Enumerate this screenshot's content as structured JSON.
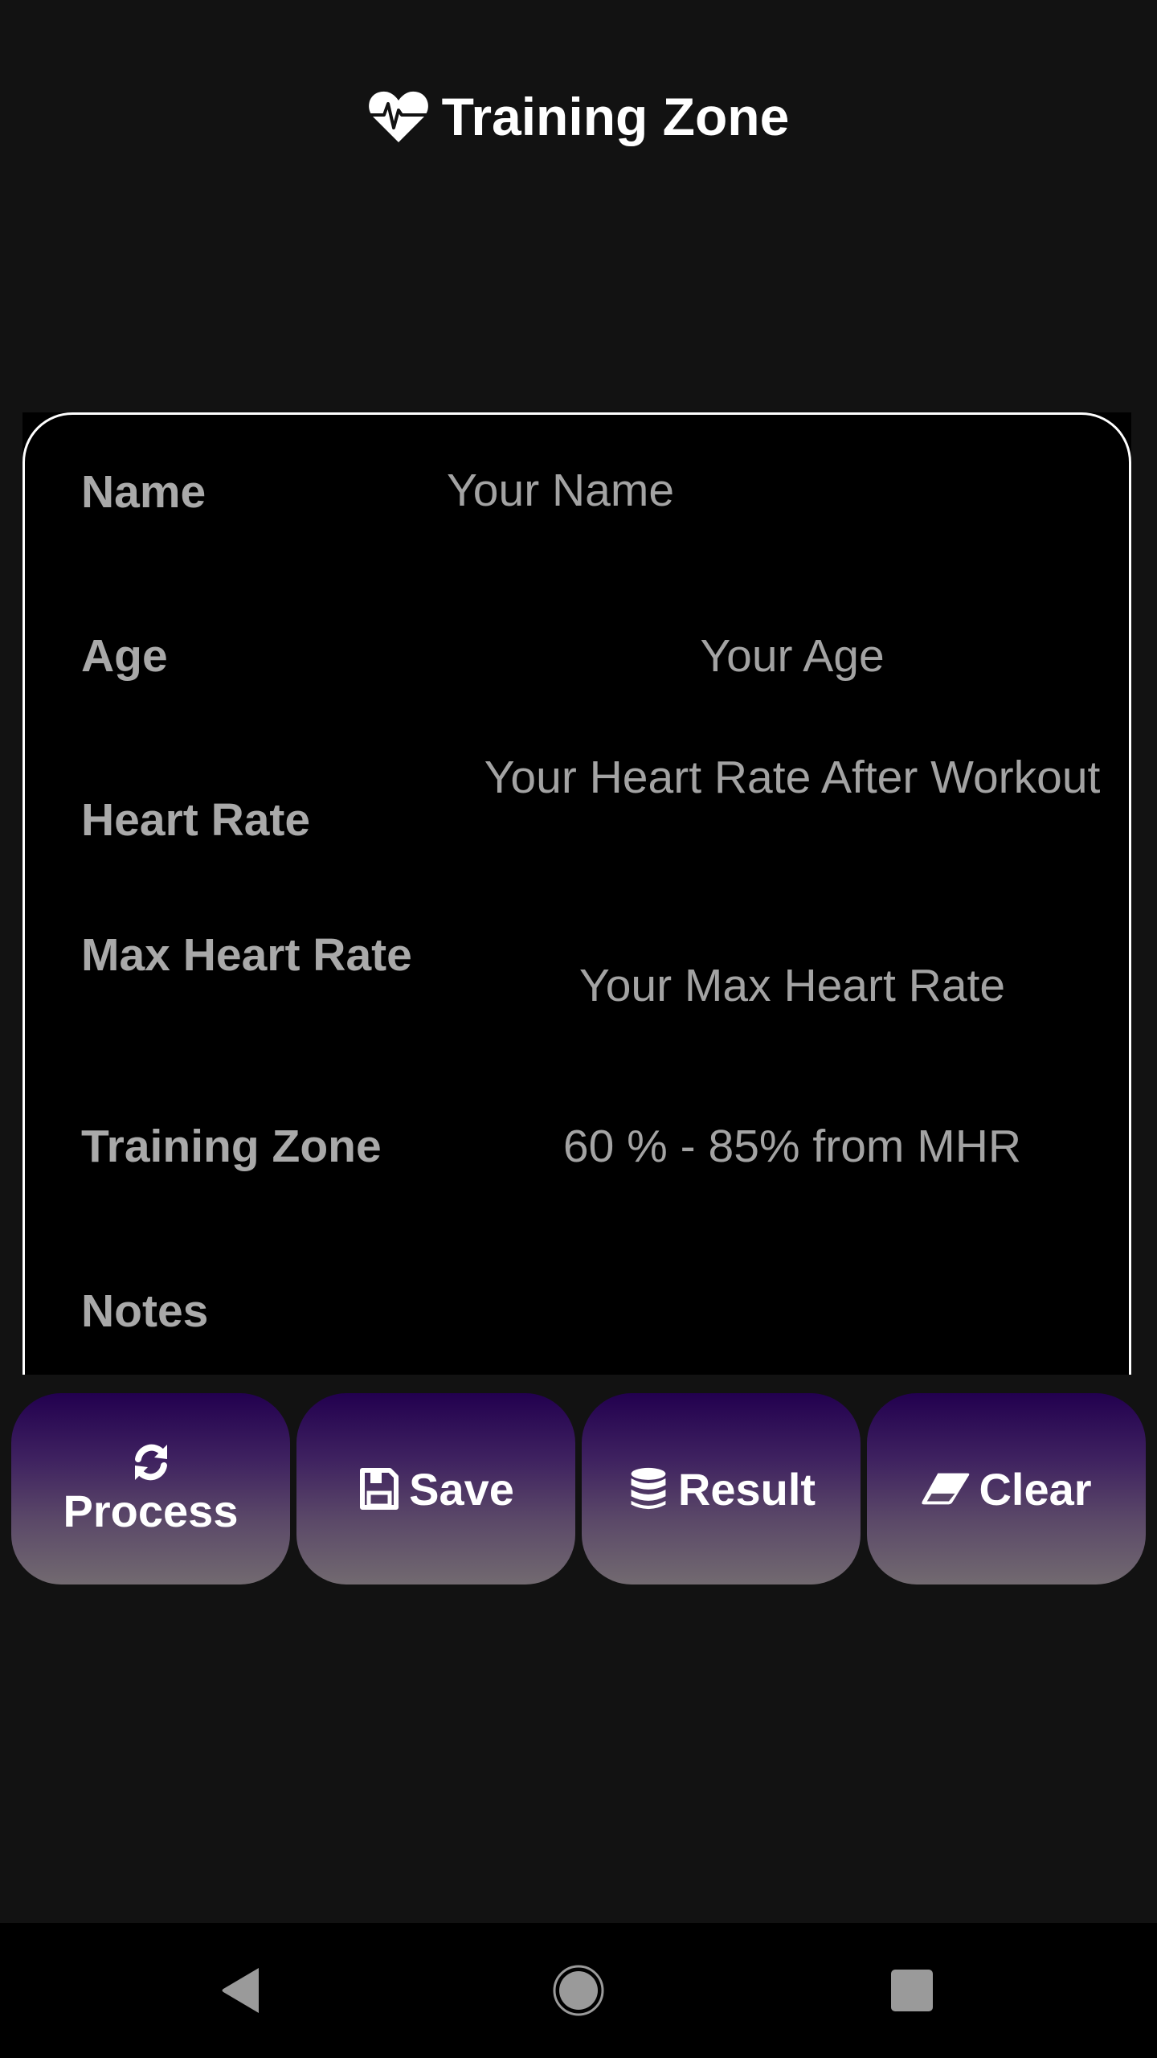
{
  "header": {
    "title": "Training Zone",
    "icon": "heart-pulse-icon"
  },
  "form": {
    "rows": [
      {
        "label": "Name",
        "placeholder": "Your Name",
        "value": ""
      },
      {
        "label": "Age",
        "placeholder": "Your Age",
        "value": ""
      },
      {
        "label": "Heart Rate",
        "placeholder": "Your Heart Rate After Workout",
        "value": ""
      },
      {
        "label": "Max Heart Rate",
        "placeholder": "Your Max Heart Rate",
        "value": ""
      },
      {
        "label": "Training Zone",
        "value": "60 % - 85% from MHR"
      },
      {
        "label": "Notes",
        "value": ""
      }
    ]
  },
  "buttons": {
    "process": {
      "label": "Process",
      "icon": "sync-icon"
    },
    "save": {
      "label": "Save",
      "icon": "floppy-disk-icon"
    },
    "result": {
      "label": "Result",
      "icon": "database-icon"
    },
    "clear": {
      "label": "Clear",
      "icon": "eraser-icon"
    }
  },
  "colors": {
    "background": "#121212",
    "card": "#000000",
    "label": "#a9a9a9",
    "button_gradient_top": "#22004f",
    "button_gradient_bottom": "#726a70"
  },
  "navbar": {
    "back": "back-triangle-icon",
    "home": "home-circle-icon",
    "recents": "recents-square-icon"
  }
}
